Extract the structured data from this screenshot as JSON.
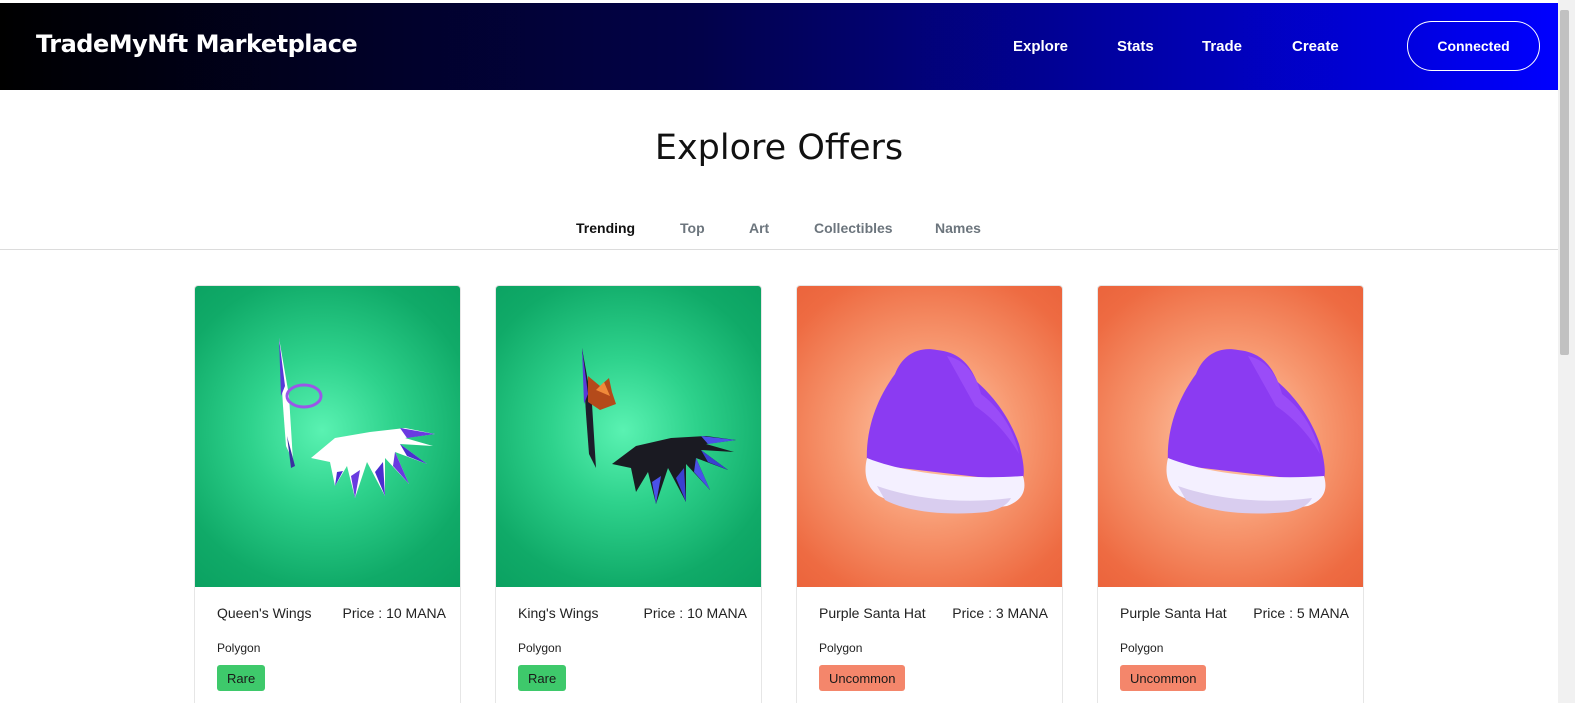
{
  "navbar": {
    "brand": "TradeMyNft Marketplace",
    "links": [
      "Explore",
      "Stats",
      "Trade",
      "Create"
    ],
    "connect_label": "Connected",
    "gradient_colors": [
      "#000000",
      "#02024a",
      "#0000ff"
    ]
  },
  "page": {
    "title": "Explore Offers"
  },
  "tabs": [
    {
      "label": "Trending",
      "active": true
    },
    {
      "label": "Top",
      "active": false
    },
    {
      "label": "Art",
      "active": false
    },
    {
      "label": "Collectibles",
      "active": false
    },
    {
      "label": "Names",
      "active": false
    }
  ],
  "cards": [
    {
      "name": "Queen's Wings",
      "price": "Price : 10 MANA",
      "chain": "Polygon",
      "rarity": "Rare",
      "rarity_color": "#3ec96b",
      "bg": "green",
      "image": "wings-white-icon"
    },
    {
      "name": "King's Wings",
      "price": "Price : 10 MANA",
      "chain": "Polygon",
      "rarity": "Rare",
      "rarity_color": "#3ec96b",
      "bg": "green",
      "image": "wings-black-icon"
    },
    {
      "name": "Purple Santa Hat",
      "price": "Price : 3 MANA",
      "chain": "Polygon",
      "rarity": "Uncommon",
      "rarity_color": "#f4866b",
      "bg": "orange",
      "image": "purple-hat-icon"
    },
    {
      "name": "Purple Santa Hat",
      "price": "Price : 5 MANA",
      "chain": "Polygon",
      "rarity": "Uncommon",
      "rarity_color": "#f4866b",
      "bg": "orange",
      "image": "purple-hat-icon"
    }
  ]
}
